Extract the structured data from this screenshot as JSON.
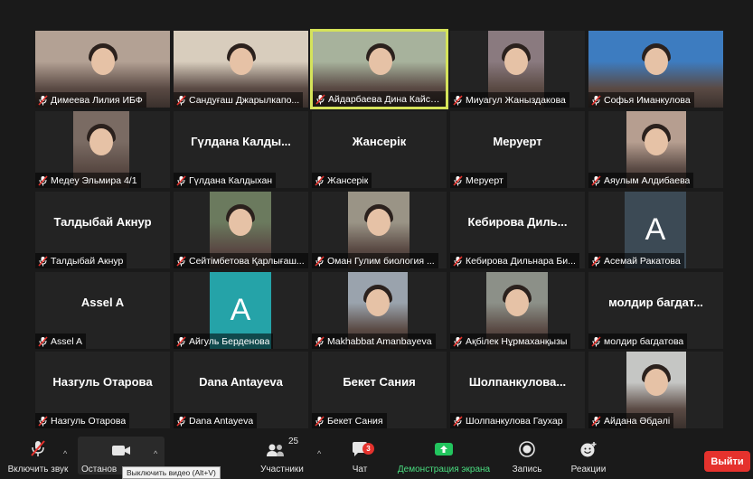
{
  "participants": [
    {
      "name": "Димеева Лилия ИБФ",
      "bg": "#8d7e73",
      "thumb": "#b3a194"
    },
    {
      "name": "Сандуғаш Джарылкапо...",
      "bg": "#c7b9a3",
      "thumb": "#d8cdbd"
    },
    {
      "name": "Айдарбаева Дина Кайсар...",
      "bg": "#8e9a86",
      "thumb": "#a7b29c"
    },
    {
      "name": "Миуагул Жаныздакова",
      "bg": "#232323",
      "thumb": "#8a7a7f"
    },
    {
      "name": "Софья Иманкулова",
      "bg": "#2e6cb0",
      "thumb": "#3d7cc0"
    },
    {
      "name": "Медеу Эльмира 4/1",
      "bg": "#232323",
      "thumb": "#7a6b63"
    },
    {
      "name": "Гүлдана Калдыхан",
      "big": "Гүлдана Калды..."
    },
    {
      "name": "Жансерік",
      "big": "Жансерік"
    },
    {
      "name": "Меруерт",
      "big": "Меруерт"
    },
    {
      "name": "Аяулым Алдибаева",
      "bg": "#232323",
      "thumb": "#b69e90"
    },
    {
      "name": "Талдыбай Акнур",
      "big": "Талдыбай Акнур"
    },
    {
      "name": "Сейтімбетова Қарлығаш...",
      "bg": "#232323",
      "thumb": "#6b7a5e"
    },
    {
      "name": "Оман Гулим биология ...",
      "bg": "#232323",
      "thumb": "#9a9486"
    },
    {
      "name": "Кебирова Дильнара Би...",
      "big": "Кебирова Диль..."
    },
    {
      "name": "Асемай Ракатова",
      "avatar": "A",
      "avatar_color": "#3c4a55"
    },
    {
      "name": "Assel A",
      "big": "Assel A"
    },
    {
      "name": "Айгуль Берденова",
      "avatar": "A",
      "avatar_color": "#25a3a8"
    },
    {
      "name": "Makhabbat Amanbayeva",
      "bg": "#232323",
      "thumb": "#9aa3ad"
    },
    {
      "name": "Ақбілек Нұрмаханқызы",
      "bg": "#232323",
      "thumb": "#8c9088"
    },
    {
      "name": "молдир багдатова",
      "big": "молдир багдат..."
    },
    {
      "name": "Назгуль Отарова",
      "big": "Назгуль Отарова"
    },
    {
      "name": "Dana Antayeva",
      "big": "Dana Antayeva"
    },
    {
      "name": "Бекет Сания",
      "big": "Бекет Сания"
    },
    {
      "name": "Шолпанкулова Гаухар",
      "big": "Шолпанкулова..."
    },
    {
      "name": "Айдана Әбдәлі",
      "bg": "#232323",
      "thumb": "#c5c6c4"
    }
  ],
  "toolbar": {
    "mute_label": "Включить звук",
    "video_label": "Останов",
    "tooltip": "Выключить видео (Alt+V)",
    "participants_label": "Участники",
    "participants_count": "25",
    "chat_label": "Чат",
    "chat_badge": "3",
    "share_label": "Демонстрация экрана",
    "record_label": "Запись",
    "reactions_label": "Реакции",
    "end_label": "Выйти"
  },
  "colors": {
    "active_speaker": "#d5e35a",
    "end_button": "#e5322d",
    "share_green": "#22c55e",
    "muted_red": "#e5322d"
  }
}
